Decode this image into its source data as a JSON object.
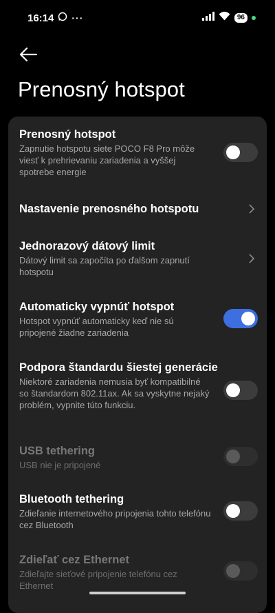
{
  "status": {
    "time": "16:14",
    "battery": "96"
  },
  "page": {
    "title": "Prenosný hotspot"
  },
  "settings": {
    "hotspot": {
      "title": "Prenosný hotspot",
      "desc": "Zapnutie hotspotu siete POCO F8 Pro môže viesť k prehrievaniu zariadenia a vyššej spotrebe energie",
      "enabled": false
    },
    "hotspot_setup": {
      "title": "Nastavenie prenosného hotspotu"
    },
    "data_limit": {
      "title": "Jednorazový dátový limit",
      "desc": "Dátový limit sa započíta po ďalšom zapnutí hotspotu"
    },
    "auto_off": {
      "title": "Automaticky vypnúť hotspot",
      "desc": "Hotspot vypnúť automaticky keď nie sú pripojené žiadne zariadenia",
      "enabled": true
    },
    "wifi6": {
      "title": "Podpora štandardu šiestej generácie",
      "desc": "Niektoré zariadenia nemusia byť kompatibilné so štandardom 802.11ax. Ak sa vyskytne nejaký problém, vypnite túto funkciu.",
      "enabled": false
    },
    "usb": {
      "title": "USB tethering",
      "desc": "USB nie je pripojené",
      "enabled": false
    },
    "bluetooth": {
      "title": "Bluetooth tethering",
      "desc": "Zdieľanie internetového pripojenia tohto telefónu cez Bluetooth",
      "enabled": false
    },
    "ethernet": {
      "title": "Zdieľať cez Ethernet",
      "desc": "Zdieľajte sieťové pripojenie telefónu cez Ethernet",
      "enabled": false
    }
  },
  "colors": {
    "accent": "#3d6fe0",
    "card": "#232323",
    "background": "#000000"
  }
}
